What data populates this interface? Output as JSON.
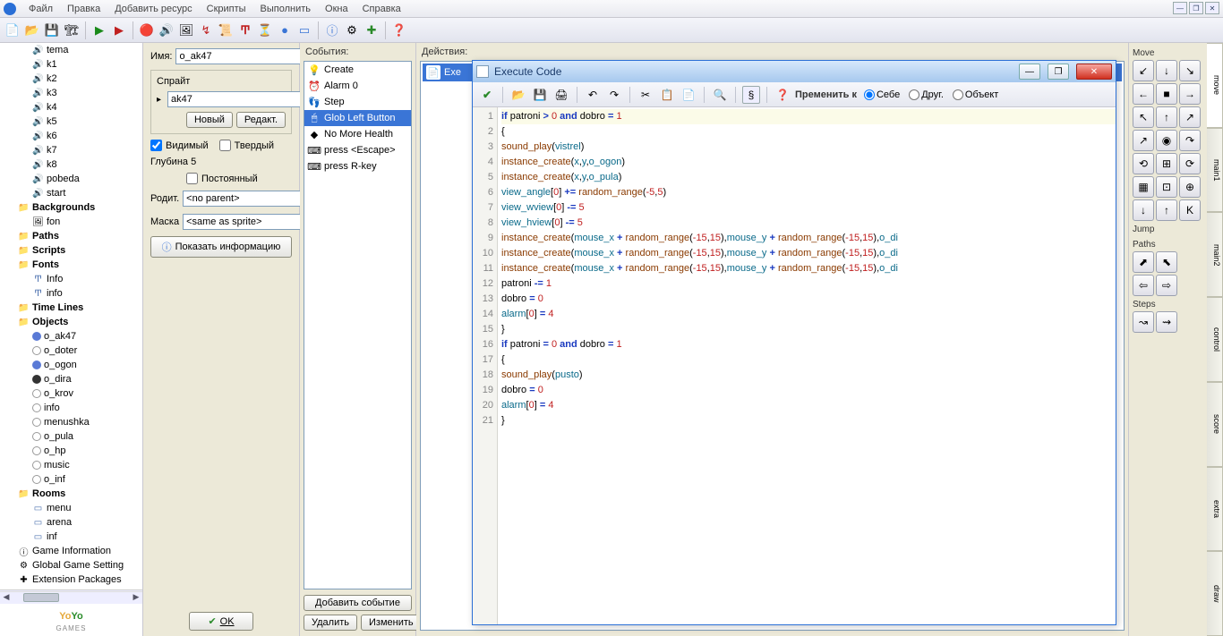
{
  "menu": {
    "items": [
      "Файл",
      "Правка",
      "Добавить ресурс",
      "Скрипты",
      "Выполнить",
      "Окна",
      "Справка"
    ]
  },
  "tree": {
    "sounds": [
      "tema",
      "k1",
      "k2",
      "k3",
      "k4",
      "k5",
      "k6",
      "k7",
      "k8",
      "pobeda",
      "start"
    ],
    "backgrounds_label": "Backgrounds",
    "backgrounds": [
      "fon"
    ],
    "paths_label": "Paths",
    "scripts_label": "Scripts",
    "fonts_label": "Fonts",
    "fonts": [
      "Info",
      "info"
    ],
    "timelines_label": "Time Lines",
    "objects_label": "Objects",
    "objects": [
      "o_ak47",
      "o_doter",
      "o_ogon",
      "o_dira",
      "o_krov",
      "info",
      "menushka",
      "o_pula",
      "o_hp",
      "music",
      "o_inf"
    ],
    "rooms_label": "Rooms",
    "rooms": [
      "menu",
      "arena",
      "inf"
    ],
    "gameinfo": "Game Information",
    "globalsettings": "Global Game Setting",
    "extpkg": "Extension Packages"
  },
  "objpanel": {
    "name_label": "Имя:",
    "name_value": "o_ak47",
    "sprite_label": "Спрайт",
    "sprite_value": "ak47",
    "new_btn": "Новый",
    "edit_btn": "Редакт.",
    "visible_label": "Видимый",
    "solid_label": "Твердый",
    "depth_label": "Глубина 5",
    "persistent_label": "Постоянный",
    "parent_label": "Родит.",
    "parent_value": "<no parent>",
    "mask_label": "Маска",
    "mask_value": "<same as sprite>",
    "info_btn": "Показать информацию",
    "ok_btn": "OK"
  },
  "events": {
    "head": "События:",
    "items": [
      {
        "icon": "💡",
        "label": "Create"
      },
      {
        "icon": "⏰",
        "label": "Alarm 0"
      },
      {
        "icon": "👣",
        "label": "Step"
      },
      {
        "icon": "🖱",
        "label": "Glob Left Button"
      },
      {
        "icon": "◆",
        "label": "No More Health"
      },
      {
        "icon": "⌨",
        "label": "press <Escape>"
      },
      {
        "icon": "⌨",
        "label": "press R-key"
      }
    ],
    "selected": 3,
    "add_btn": "Добавить событие",
    "del_btn": "Удалить",
    "edit_btn": "Изменить"
  },
  "actions": {
    "head": "Действия:",
    "items": [
      {
        "label": "Exe"
      }
    ]
  },
  "palette": {
    "tabs": [
      "move",
      "main1",
      "main2",
      "control",
      "score",
      "extra",
      "draw"
    ],
    "sections": [
      {
        "label": "Move",
        "rows": [
          [
            "↙",
            "↓",
            "↘"
          ],
          [
            "←",
            "■",
            "→"
          ],
          [
            "↖",
            "↑",
            "↗"
          ]
        ]
      },
      {
        "label": "",
        "rows": [
          [
            "↗",
            "◉",
            "↷"
          ],
          [
            "⟲",
            "⊞",
            "⟳"
          ],
          [
            "▦",
            "⊡",
            "⊕"
          ],
          [
            "↓",
            "↑",
            "K"
          ]
        ]
      },
      {
        "label": "Jump",
        "rows": [
          []
        ]
      },
      {
        "label": "Paths",
        "rows": [
          [
            "⬈",
            "⬉"
          ],
          [
            "⇦",
            "⇨"
          ]
        ]
      },
      {
        "label": "Steps",
        "rows": [
          [
            "↝",
            "⇝"
          ]
        ]
      }
    ]
  },
  "codewin": {
    "title": "Execute Code",
    "apply_label": "Пременить к",
    "radios": [
      "Себе",
      "Друг.",
      "Объект"
    ],
    "lines": [
      [
        [
          "kw",
          "if"
        ],
        [
          "plain",
          " patroni "
        ],
        [
          "kw",
          ">"
        ],
        [
          "plain",
          " "
        ],
        [
          "num",
          "0"
        ],
        [
          "plain",
          " "
        ],
        [
          "kw",
          "and"
        ],
        [
          "plain",
          " dobro "
        ],
        [
          "kw",
          "="
        ],
        [
          "plain",
          " "
        ],
        [
          "num",
          "1"
        ]
      ],
      [
        [
          "punct",
          "{"
        ]
      ],
      [
        [
          "fn",
          "sound_play"
        ],
        [
          "punct",
          "("
        ],
        [
          "var",
          "vistrel"
        ],
        [
          "punct",
          ")"
        ]
      ],
      [
        [
          "fn",
          "instance_create"
        ],
        [
          "punct",
          "("
        ],
        [
          "var",
          "x"
        ],
        [
          "punct",
          ","
        ],
        [
          "var",
          "y"
        ],
        [
          "punct",
          ","
        ],
        [
          "var",
          "o_ogon"
        ],
        [
          "punct",
          ")"
        ]
      ],
      [
        [
          "fn",
          "instance_create"
        ],
        [
          "punct",
          "("
        ],
        [
          "var",
          "x"
        ],
        [
          "punct",
          ","
        ],
        [
          "var",
          "y"
        ],
        [
          "punct",
          ","
        ],
        [
          "var",
          "o_pula"
        ],
        [
          "punct",
          ")"
        ]
      ],
      [
        [
          "var",
          "view_angle"
        ],
        [
          "punct",
          "["
        ],
        [
          "num",
          "0"
        ],
        [
          "punct",
          "]"
        ],
        [
          "plain",
          " "
        ],
        [
          "kw",
          "+="
        ],
        [
          "plain",
          " "
        ],
        [
          "fn",
          "random_range"
        ],
        [
          "punct",
          "("
        ],
        [
          "num",
          "-5"
        ],
        [
          "punct",
          ","
        ],
        [
          "num",
          "5"
        ],
        [
          "punct",
          ")"
        ]
      ],
      [
        [
          "var",
          "view_wview"
        ],
        [
          "punct",
          "["
        ],
        [
          "num",
          "0"
        ],
        [
          "punct",
          "]"
        ],
        [
          "plain",
          " "
        ],
        [
          "kw",
          "-="
        ],
        [
          "plain",
          " "
        ],
        [
          "num",
          "5"
        ]
      ],
      [
        [
          "var",
          "view_hview"
        ],
        [
          "punct",
          "["
        ],
        [
          "num",
          "0"
        ],
        [
          "punct",
          "]"
        ],
        [
          "plain",
          " "
        ],
        [
          "kw",
          "-="
        ],
        [
          "plain",
          " "
        ],
        [
          "num",
          "5"
        ]
      ],
      [
        [
          "fn",
          "instance_create"
        ],
        [
          "punct",
          "("
        ],
        [
          "var",
          "mouse_x"
        ],
        [
          "plain",
          " "
        ],
        [
          "kw",
          "+"
        ],
        [
          "plain",
          " "
        ],
        [
          "fn",
          "random_range"
        ],
        [
          "punct",
          "("
        ],
        [
          "num",
          "-15"
        ],
        [
          "punct",
          ","
        ],
        [
          "num",
          "15"
        ],
        [
          "punct",
          ")"
        ],
        [
          "punct",
          ","
        ],
        [
          "var",
          "mouse_y"
        ],
        [
          "plain",
          " "
        ],
        [
          "kw",
          "+"
        ],
        [
          "plain",
          " "
        ],
        [
          "fn",
          "random_range"
        ],
        [
          "punct",
          "("
        ],
        [
          "num",
          "-15"
        ],
        [
          "punct",
          ","
        ],
        [
          "num",
          "15"
        ],
        [
          "punct",
          ")"
        ],
        [
          "punct",
          ","
        ],
        [
          "var",
          "o_di"
        ]
      ],
      [
        [
          "fn",
          "instance_create"
        ],
        [
          "punct",
          "("
        ],
        [
          "var",
          "mouse_x"
        ],
        [
          "plain",
          " "
        ],
        [
          "kw",
          "+"
        ],
        [
          "plain",
          " "
        ],
        [
          "fn",
          "random_range"
        ],
        [
          "punct",
          "("
        ],
        [
          "num",
          "-15"
        ],
        [
          "punct",
          ","
        ],
        [
          "num",
          "15"
        ],
        [
          "punct",
          ")"
        ],
        [
          "punct",
          ","
        ],
        [
          "var",
          "mouse_y"
        ],
        [
          "plain",
          " "
        ],
        [
          "kw",
          "+"
        ],
        [
          "plain",
          " "
        ],
        [
          "fn",
          "random_range"
        ],
        [
          "punct",
          "("
        ],
        [
          "num",
          "-15"
        ],
        [
          "punct",
          ","
        ],
        [
          "num",
          "15"
        ],
        [
          "punct",
          ")"
        ],
        [
          "punct",
          ","
        ],
        [
          "var",
          "o_di"
        ]
      ],
      [
        [
          "fn",
          "instance_create"
        ],
        [
          "punct",
          "("
        ],
        [
          "var",
          "mouse_x"
        ],
        [
          "plain",
          " "
        ],
        [
          "kw",
          "+"
        ],
        [
          "plain",
          " "
        ],
        [
          "fn",
          "random_range"
        ],
        [
          "punct",
          "("
        ],
        [
          "num",
          "-15"
        ],
        [
          "punct",
          ","
        ],
        [
          "num",
          "15"
        ],
        [
          "punct",
          ")"
        ],
        [
          "punct",
          ","
        ],
        [
          "var",
          "mouse_y"
        ],
        [
          "plain",
          " "
        ],
        [
          "kw",
          "+"
        ],
        [
          "plain",
          " "
        ],
        [
          "fn",
          "random_range"
        ],
        [
          "punct",
          "("
        ],
        [
          "num",
          "-15"
        ],
        [
          "punct",
          ","
        ],
        [
          "num",
          "15"
        ],
        [
          "punct",
          ")"
        ],
        [
          "punct",
          ","
        ],
        [
          "var",
          "o_di"
        ]
      ],
      [
        [
          "plain",
          "patroni "
        ],
        [
          "kw",
          "-="
        ],
        [
          "plain",
          " "
        ],
        [
          "num",
          "1"
        ]
      ],
      [
        [
          "plain",
          "dobro "
        ],
        [
          "kw",
          "="
        ],
        [
          "plain",
          " "
        ],
        [
          "num",
          "0"
        ]
      ],
      [
        [
          "var",
          "alarm"
        ],
        [
          "punct",
          "["
        ],
        [
          "num",
          "0"
        ],
        [
          "punct",
          "]"
        ],
        [
          "plain",
          " "
        ],
        [
          "kw",
          "="
        ],
        [
          "plain",
          " "
        ],
        [
          "num",
          "4"
        ]
      ],
      [
        [
          "punct",
          "}"
        ]
      ],
      [
        [
          "kw",
          "if"
        ],
        [
          "plain",
          " patroni "
        ],
        [
          "kw",
          "="
        ],
        [
          "plain",
          " "
        ],
        [
          "num",
          "0"
        ],
        [
          "plain",
          " "
        ],
        [
          "kw",
          "and"
        ],
        [
          "plain",
          " dobro "
        ],
        [
          "kw",
          "="
        ],
        [
          "plain",
          " "
        ],
        [
          "num",
          "1"
        ]
      ],
      [
        [
          "punct",
          "{"
        ]
      ],
      [
        [
          "fn",
          "sound_play"
        ],
        [
          "punct",
          "("
        ],
        [
          "var",
          "pusto"
        ],
        [
          "punct",
          ")"
        ]
      ],
      [
        [
          "plain",
          "dobro "
        ],
        [
          "kw",
          "="
        ],
        [
          "plain",
          " "
        ],
        [
          "num",
          "0"
        ]
      ],
      [
        [
          "var",
          "alarm"
        ],
        [
          "punct",
          "["
        ],
        [
          "num",
          "0"
        ],
        [
          "punct",
          "]"
        ],
        [
          "plain",
          " "
        ],
        [
          "kw",
          "="
        ],
        [
          "plain",
          " "
        ],
        [
          "num",
          "4"
        ]
      ],
      [
        [
          "punct",
          "}"
        ]
      ]
    ]
  }
}
